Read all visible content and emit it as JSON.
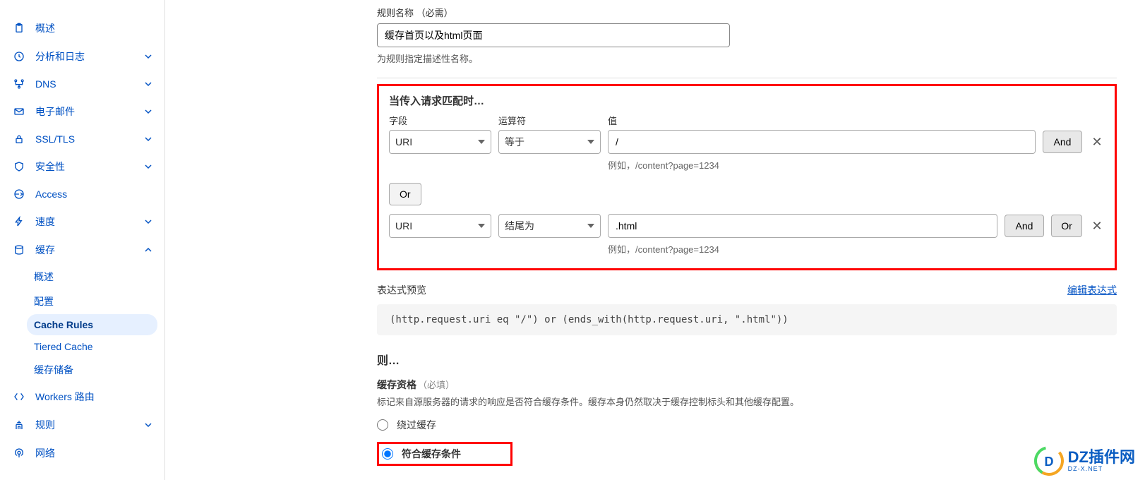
{
  "sidebar": {
    "items": [
      {
        "label": "概述",
        "icon": "clipboard"
      },
      {
        "label": "分析和日志",
        "icon": "clock",
        "expandable": true
      },
      {
        "label": "DNS",
        "icon": "dns",
        "expandable": true
      },
      {
        "label": "电子邮件",
        "icon": "mail",
        "expandable": true
      },
      {
        "label": "SSL/TLS",
        "icon": "lock",
        "expandable": true
      },
      {
        "label": "安全性",
        "icon": "shield",
        "expandable": true
      },
      {
        "label": "Access",
        "icon": "access"
      },
      {
        "label": "速度",
        "icon": "bolt",
        "expandable": true
      },
      {
        "label": "缓存",
        "icon": "cache",
        "expandable": true,
        "expanded": true,
        "children": [
          {
            "label": "概述"
          },
          {
            "label": "配置"
          },
          {
            "label": "Cache Rules",
            "active": true
          },
          {
            "label": "Tiered Cache"
          },
          {
            "label": "缓存储备"
          }
        ]
      },
      {
        "label": "Workers 路由",
        "icon": "workers"
      },
      {
        "label": "规则",
        "icon": "rules",
        "expandable": true
      },
      {
        "label": "网络",
        "icon": "network"
      }
    ]
  },
  "rule_name": {
    "label": "规则名称 （必需）",
    "value": "缓存首页以及html页面",
    "help": "为规则指定描述性名称。"
  },
  "match": {
    "title": "当传入请求匹配时…",
    "col_field": "字段",
    "col_op": "运算符",
    "col_val": "值",
    "rows": [
      {
        "field": "URI",
        "op": "等于",
        "value": "/",
        "example": "例如，/content?page=1234",
        "and_label": "And"
      },
      {
        "field": "URI",
        "op": "结尾为",
        "value": ".html",
        "example": "例如，/content?page=1234",
        "and_label": "And",
        "or_label": "Or"
      }
    ],
    "or_btn": "Or"
  },
  "preview": {
    "label": "表达式预览",
    "edit": "编辑表达式",
    "code": "(http.request.uri eq \"/\") or (ends_with(http.request.uri, \".html\"))"
  },
  "then": {
    "title": "则…",
    "cache_eligibility": "缓存资格",
    "required": "（必填）",
    "desc": "标记来自源服务器的请求的响应是否符合缓存条件。缓存本身仍然取决于缓存控制标头和其他缓存配置。",
    "opt_bypass": "绕过缓存",
    "opt_eligible": "符合缓存条件"
  },
  "watermark": {
    "brand": "DZ插件网",
    "sub": "DZ-X.NET"
  }
}
